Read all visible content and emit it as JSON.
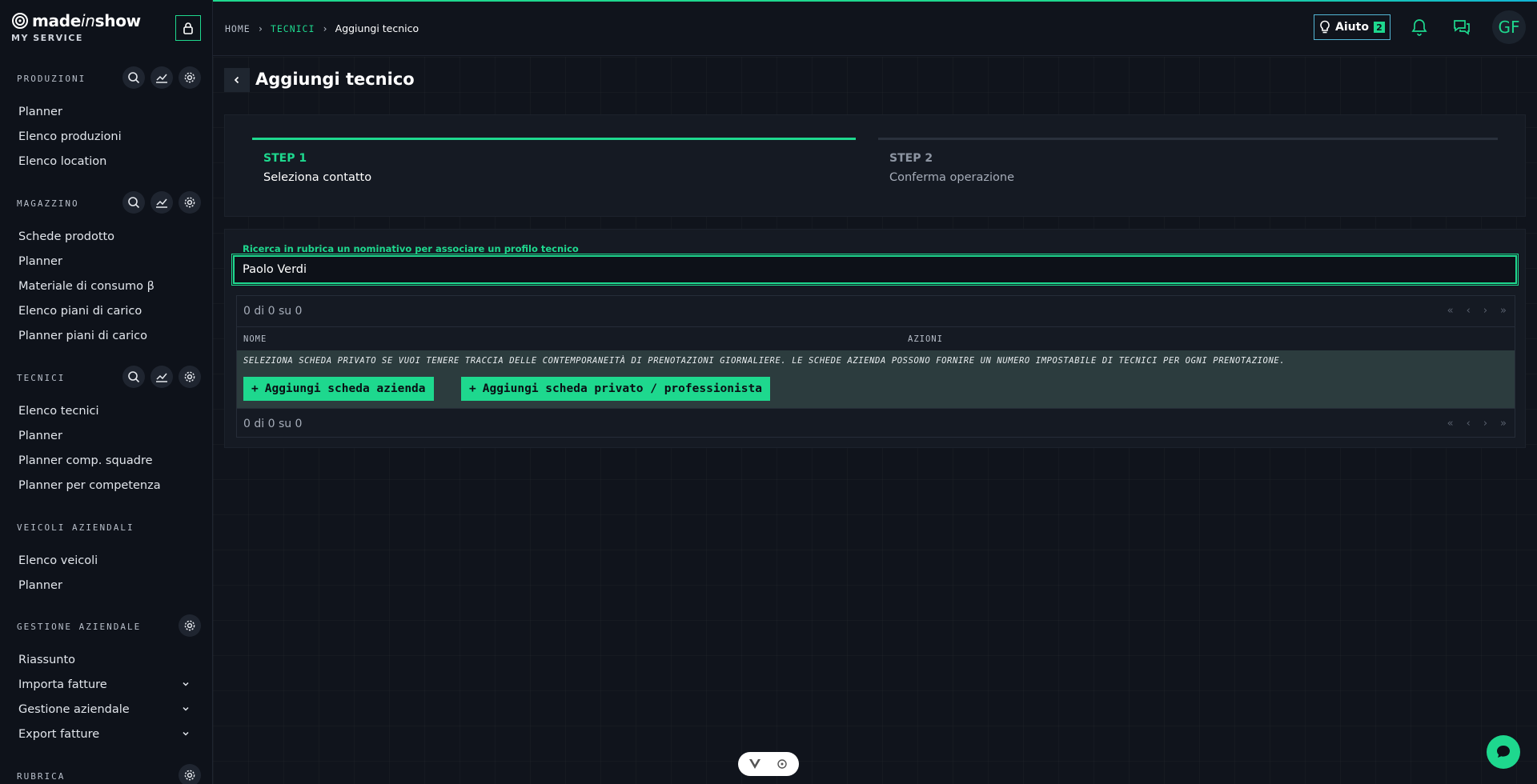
{
  "brand": {
    "name_prefix": "made",
    "name_italic": "in",
    "name_suffix": "show",
    "subtitle": "MY SERVICE"
  },
  "sidebar": {
    "sections": [
      {
        "title": "PRODUZIONI",
        "items": [
          "Planner",
          "Elenco produzioni",
          "Elenco location"
        ]
      },
      {
        "title": "MAGAZZINO",
        "items": [
          "Schede prodotto",
          "Planner",
          "Materiale di consumo β",
          "Elenco piani di carico",
          "Planner piani di carico"
        ]
      },
      {
        "title": "TECNICI",
        "items": [
          "Elenco tecnici",
          "Planner",
          "Planner comp. squadre",
          "Planner per competenza"
        ]
      },
      {
        "title": "VEICOLI AZIENDALI",
        "items": [
          "Elenco veicoli",
          "Planner"
        ]
      },
      {
        "title": "GESTIONE AZIENDALE",
        "items": [
          "Riassunto",
          "Importa fatture",
          "Gestione aziendale",
          "Export fatture"
        ]
      },
      {
        "title": "RUBRICA",
        "items": []
      }
    ]
  },
  "breadcrumb": {
    "home": "HOME",
    "section": "TECNICI",
    "current": "Aggiungi tecnico"
  },
  "topbar": {
    "help_label": "Aiuto",
    "help_badge": "2",
    "avatar_initials": "GF"
  },
  "page": {
    "title": "Aggiungi tecnico"
  },
  "stepper": {
    "steps": [
      {
        "label": "STEP 1",
        "description": "Seleziona contatto",
        "active": true
      },
      {
        "label": "STEP 2",
        "description": "Conferma operazione",
        "active": false
      }
    ]
  },
  "search": {
    "label": "Ricerca in rubrica un nominativo per associare un profilo tecnico",
    "value": "Paolo Verdi"
  },
  "table": {
    "pager_text": "0 di 0 su 0",
    "columns": [
      "NOME",
      "AZIONI"
    ],
    "empty_message": "Seleziona scheda privato se vuoi tenere traccia delle contemporaneità di prenotazioni giornaliere. Le schede azienda possono fornire un numero impostabile di tecnici per ogni prenotazione.",
    "add_company_label": "Aggiungi scheda azienda",
    "add_private_label": "Aggiungi scheda privato / professionista"
  },
  "colors": {
    "accent": "#1ed88e",
    "help_border": "#53b6d6",
    "background": "#10141c",
    "row_highlight": "#2c3c3e"
  }
}
